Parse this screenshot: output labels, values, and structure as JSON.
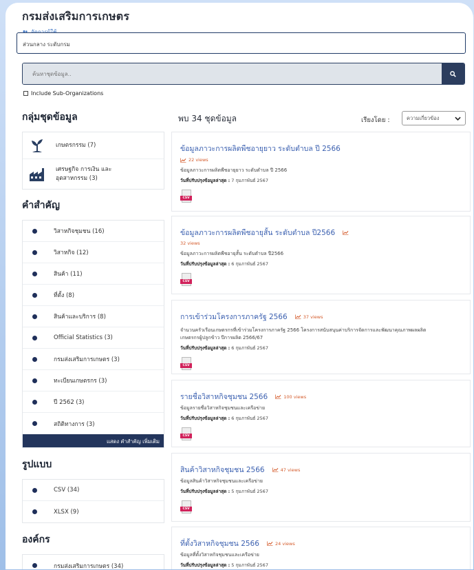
{
  "header": {
    "org_title": "กรมส่งเสริมการเกษตร",
    "manage_label": "จัดการผู้ใช้"
  },
  "path_box": {
    "value": "ส่วนกลาง ระดับกรม"
  },
  "search": {
    "placeholder": "ค้นหาชุดข้อมูล..",
    "icon": "search-icon"
  },
  "sub_org": {
    "label": "Include Sub-Organizations",
    "checked": false
  },
  "groups": {
    "heading": "กลุ่มชุดข้อมูล",
    "items": [
      {
        "label": "เกษตรกรรม (7)",
        "icon": "plant-icon"
      },
      {
        "label_line1": "เศรษฐกิจ การเงิน และ",
        "label_line2": "อุตสาหกรรม (3)",
        "icon": "factory-icon"
      }
    ]
  },
  "keywords": {
    "heading": "คำสำคัญ",
    "items": [
      "วิสาหกิจชุมชน (16)",
      "วิสาหกิจ (12)",
      "สินค้า (11)",
      "ที่ตั้ง (8)",
      "สินค้าและบริการ (8)",
      "Official Statistics (3)",
      "กรมส่งเสริมการเกษตร (3)",
      "ทะเบียนเกษตรกร (3)",
      "ปี 2562 (3)",
      "สถิติทางการ (3)"
    ],
    "more_label": "แสดง คำสำคัญ เพิ่มเติม"
  },
  "formats": {
    "heading": "รูปแบบ",
    "items": [
      "CSV (34)",
      "XLSX (9)"
    ]
  },
  "organizations": {
    "heading": "องค์กร",
    "items": [
      "กรมส่งเสริมการเกษตร (34)"
    ]
  },
  "results": {
    "count_label": "พบ 34 ชุดข้อมูล",
    "sort_label": "เรียงโดย :",
    "sort_value": "ความเกี่ยวข้อง",
    "updated_label": "วันที่ปรับปรุงข้อมูลล่าสุด :",
    "datasets": [
      {
        "title": "ข้อมูลภาวะการผลิตพืชอายุยาว ระดับตำบล ปี 2566",
        "views": "22 views",
        "desc": "ข้อมูลภาวะการผลิตพืชอายุยาว ระดับตำบล ปี 2566",
        "desc2": "",
        "date": "7 กุมภาพันธ์ 2567",
        "format": "CSV"
      },
      {
        "title": "ข้อมูลภาวะการผลิตพืชอายุสั้น ระดับตำบล ปี2566",
        "views": "32 views",
        "desc": "ข้อมูลภาวะการผลิตพืชอายุสั้น ระดับตำบล ปี2566",
        "desc2": "",
        "date": "6 กุมภาพันธ์ 2567",
        "format": "CSV"
      },
      {
        "title": "การเข้าร่วมโครงการภาครัฐ 2566",
        "views": "37 views",
        "desc": "จำนวนครัวเรือนเกษตรกรที่เข้าร่วมโครงการภาครัฐ 2566 โครงการสนับสนุนค่าบริการจัดการและพัฒนาคุณภาพผลผลิต",
        "desc2": "เกษตรกรผู้ปลูกข้าว ปีการผลิต 2566/67",
        "date": "6 กุมภาพันธ์ 2567",
        "format": "CSV"
      },
      {
        "title": "รายชื่อวิสาหกิจชุมชน 2566",
        "views": "100 views",
        "desc": "ข้อมูลรายชื่อวิสาหกิจชุมชนและเครือข่าย",
        "desc2": "",
        "date": "6 กุมภาพันธ์ 2567",
        "format": "CSV"
      },
      {
        "title": "สินค้าวิสาหกิจชุมชน 2566",
        "views": "47 views",
        "desc": "ข้อมูลสินค้าวิสาหกิจชุมชนและเครือข่าย",
        "desc2": "",
        "date": "5 กุมภาพันธ์ 2567",
        "format": "CSV"
      },
      {
        "title": "ที่ตั้งวิสาหกิจชุมชน 2566",
        "views": "24 views",
        "desc": "ข้อมูลที่ตั้งวิสาหกิจชุมชนและเครือข่าย",
        "desc2": "",
        "date": "5 กุมภาพันธ์ 2567",
        "format": "CSV"
      }
    ]
  },
  "colors": {
    "title_link": "#3b60b0",
    "views_accent": "#d45a2a",
    "dark_navy": "#23355c",
    "csv_badge": "#d1225b"
  }
}
